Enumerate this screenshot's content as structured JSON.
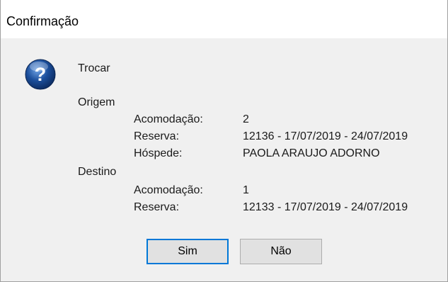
{
  "window": {
    "title": "Confirmação"
  },
  "icon": "question-icon",
  "message": {
    "action": "Trocar",
    "origin": {
      "heading": "Origem",
      "rows": [
        {
          "label": "Acomodação:",
          "value": "2"
        },
        {
          "label": "Reserva:",
          "value": "12136 - 17/07/2019 - 24/07/2019"
        },
        {
          "label": "Hóspede:",
          "value": "PAOLA ARAUJO ADORNO"
        }
      ]
    },
    "destination": {
      "heading": "Destino",
      "rows": [
        {
          "label": "Acomodação:",
          "value": "1"
        },
        {
          "label": "Reserva:",
          "value": "12133 - 17/07/2019 - 24/07/2019"
        }
      ]
    }
  },
  "buttons": {
    "yes_label": "Sim",
    "no_label": "Não"
  },
  "colors": {
    "dialog_bg": "#f0f0f0",
    "titlebar_bg": "#ffffff",
    "default_button_border": "#0078d7",
    "icon_blue": "#1c4f9c"
  }
}
